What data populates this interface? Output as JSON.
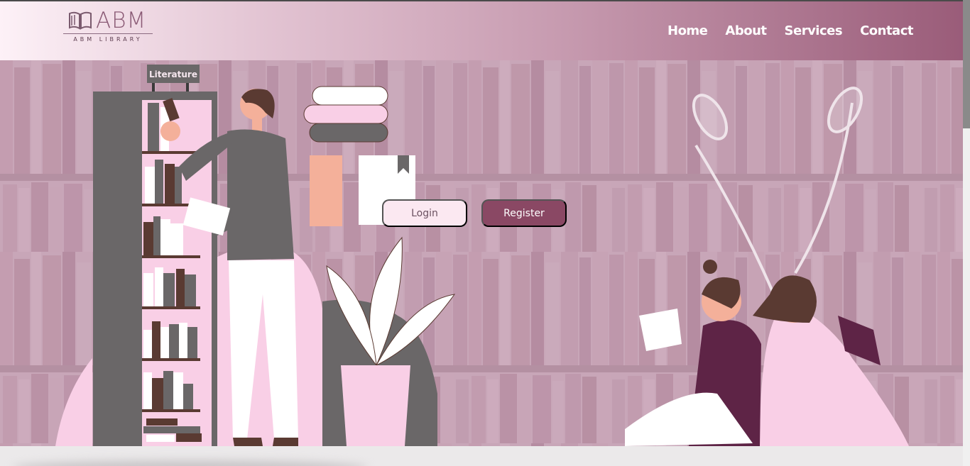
{
  "logo": {
    "letters": "ABM",
    "subtitle": "ABM LIBRARY",
    "icon": "open-book-icon"
  },
  "nav": {
    "home": "Home",
    "about": "About",
    "services": "Services",
    "contact": "Contact"
  },
  "hero": {
    "shelf_sign": "Literature",
    "login_label": "Login",
    "register_label": "Register"
  },
  "colors": {
    "brand": "#8a4864",
    "nav_gradient_start": "#fdf1f7",
    "nav_gradient_end": "#9a5c79",
    "login_bg": "#fbe8f1",
    "accent_pink": "#f9cfe6",
    "dark_gray": "#6a6768"
  }
}
